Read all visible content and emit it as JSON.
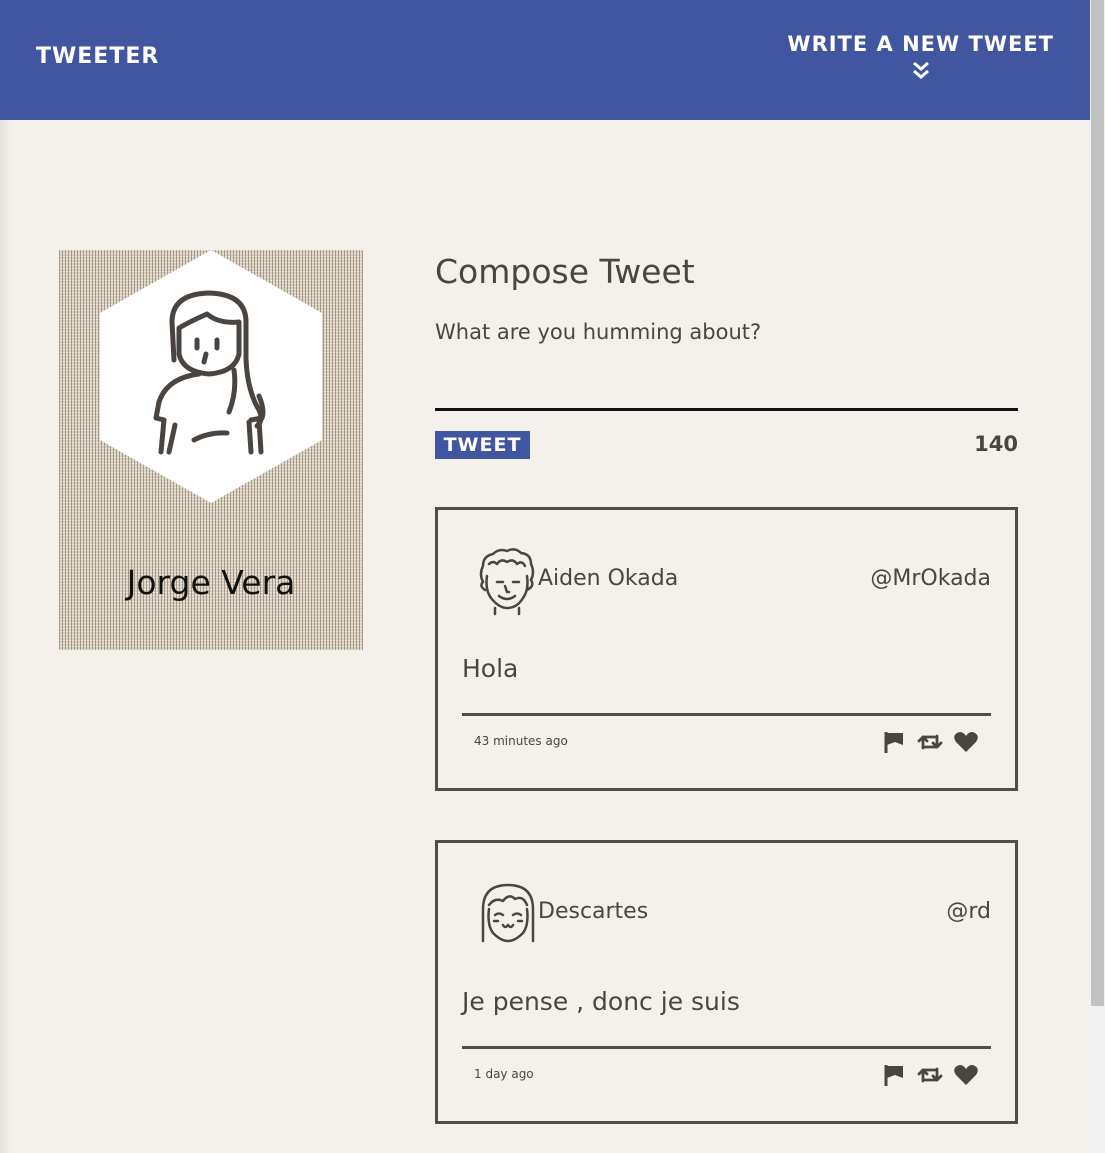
{
  "nav": {
    "brand": "TWEETER",
    "new_tweet_label": "WRITE A NEW TWEET",
    "new_tweet_icon": "double-chevron-down-icon"
  },
  "profile": {
    "name": "Jorge Vera",
    "avatar_icon": "user-woman-avatar-icon"
  },
  "compose": {
    "title": "Compose Tweet",
    "placeholder": "What are you humming about?",
    "value": "",
    "submit_label": "TWEET",
    "char_counter": "140"
  },
  "tweets": [
    {
      "name": "Aiden Okada",
      "handle": "@MrOkada",
      "content": "Hola",
      "time": "43 minutes ago",
      "avatar_icon": "curly-hair-man-avatar-icon"
    },
    {
      "name": "Descartes",
      "handle": "@rd",
      "content": "Je pense , donc je suis",
      "time": "1 day ago",
      "avatar_icon": "smiling-woman-avatar-icon"
    }
  ],
  "tweet_actions": [
    "flag-icon",
    "retweet-icon",
    "heart-icon"
  ],
  "colors": {
    "nav_bg": "#4056a1",
    "page_bg": "#f4f1ec",
    "text": "#4a4540",
    "border": "#544d45"
  }
}
